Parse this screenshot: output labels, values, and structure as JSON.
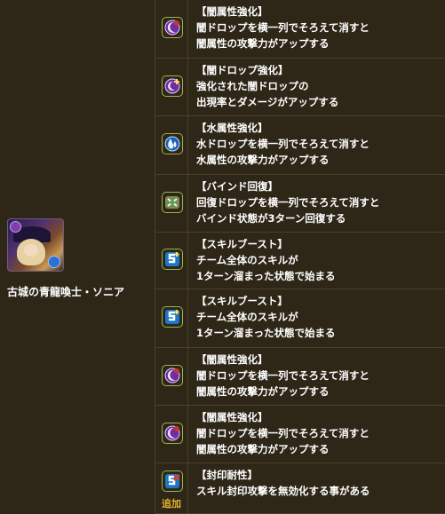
{
  "monster": {
    "name": "古城の青龍喚士・ソニア"
  },
  "awakenings": [
    {
      "icon": "dark-attribute-enhance-icon",
      "title": "【闇属性強化】",
      "lines": [
        "闇ドロップを横一列でそろえて消すと",
        "闇属性の攻撃力がアップする"
      ]
    },
    {
      "icon": "enhanced-dark-orbs-icon",
      "title": "【闇ドロップ強化】",
      "lines": [
        "強化された闇ドロップの",
        "出現率とダメージがアップする"
      ]
    },
    {
      "icon": "water-attribute-enhance-icon",
      "title": "【水属性強化】",
      "lines": [
        "水ドロップを横一列でそろえて消すと",
        "水属性の攻撃力がアップする"
      ]
    },
    {
      "icon": "bind-recovery-icon",
      "title": "【バインド回復】",
      "lines": [
        "回復ドロップを横一列でそろえて消すと",
        "バインド状態が3ターン回復する"
      ]
    },
    {
      "icon": "skill-boost-icon",
      "title": "【スキルブースト】",
      "lines": [
        "チーム全体のスキルが",
        "1ターン溜まった状態で始まる"
      ]
    },
    {
      "icon": "skill-boost-icon",
      "title": "【スキルブースト】",
      "lines": [
        "チーム全体のスキルが",
        "1ターン溜まった状態で始まる"
      ]
    },
    {
      "icon": "dark-attribute-enhance-icon",
      "title": "【闇属性強化】",
      "lines": [
        "闇ドロップを横一列でそろえて消すと",
        "闇属性の攻撃力がアップする"
      ]
    },
    {
      "icon": "dark-attribute-enhance-icon",
      "title": "【闇属性強化】",
      "lines": [
        "闇ドロップを横一列でそろえて消すと",
        "闇属性の攻撃力がアップする"
      ]
    },
    {
      "icon": "skill-bind-resist-icon",
      "title": "【封印耐性】",
      "lines": [
        "スキル封印攻撃を無効化する事がある"
      ],
      "badge": "追加"
    }
  ],
  "colors": {
    "background": "#2e2718",
    "divider": "#4a3f29",
    "text": "#ffffff",
    "badge": "#e5b431"
  }
}
